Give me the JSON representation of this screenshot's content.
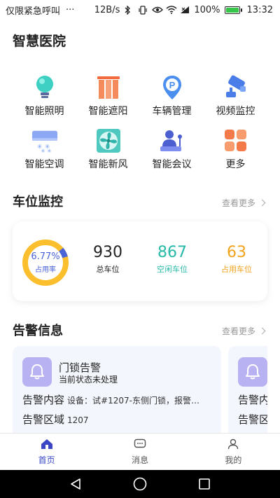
{
  "status_bar": {
    "notice": "仅限紧急呼叫",
    "more": "···",
    "speed": "12B/s",
    "battery": "100%",
    "time": "13:32",
    "battery_color": "#35c64a"
  },
  "page_title": "智慧医院",
  "apps": [
    {
      "label": "智能照明",
      "icon": "lightbulb-icon"
    },
    {
      "label": "智能遮阳",
      "icon": "sunshade-icon"
    },
    {
      "label": "车辆管理",
      "icon": "parking-pin-icon"
    },
    {
      "label": "视频监控",
      "icon": "camera-icon"
    },
    {
      "label": "智能空调",
      "icon": "air-conditioner-icon"
    },
    {
      "label": "智能新风",
      "icon": "fan-icon"
    },
    {
      "label": "智能会议",
      "icon": "meeting-icon"
    },
    {
      "label": "更多",
      "icon": "more-grid-icon"
    }
  ],
  "parking": {
    "heading": "车位监控",
    "more": "查看更多",
    "occupancy_percent": "6.77%",
    "occupancy_fraction": 0.0677,
    "occupancy_label": "占用率",
    "total_value": "930",
    "total_label": "总车位",
    "free_value": "867",
    "free_label": "空闲车位",
    "used_value": "63",
    "used_label": "占用车位",
    "colors": {
      "accent": "#4a63d8",
      "ring": "#fbbf2e",
      "free": "#27b9a8",
      "used": "#f2a21b"
    }
  },
  "alerts": {
    "heading": "告警信息",
    "more": "查看更多",
    "items": [
      {
        "title": "门锁告警",
        "status": "当前状态未处理",
        "content_label": "告警内容",
        "content_value": "设备：试#1207-东侧门锁，报警…",
        "area_label": "告警区域",
        "area_value": "1207"
      },
      {
        "title": "",
        "status": "",
        "content_label": "告警内",
        "content_value": "",
        "area_label": "告警区",
        "area_value": ""
      }
    ]
  },
  "tabs": [
    {
      "label": "首页",
      "icon": "home-icon",
      "active": true
    },
    {
      "label": "消息",
      "icon": "message-icon",
      "active": false
    },
    {
      "label": "我的",
      "icon": "user-icon",
      "active": false
    }
  ],
  "colors": {
    "brand": "#3b46c4",
    "bell_box": "#b9b2f2"
  }
}
